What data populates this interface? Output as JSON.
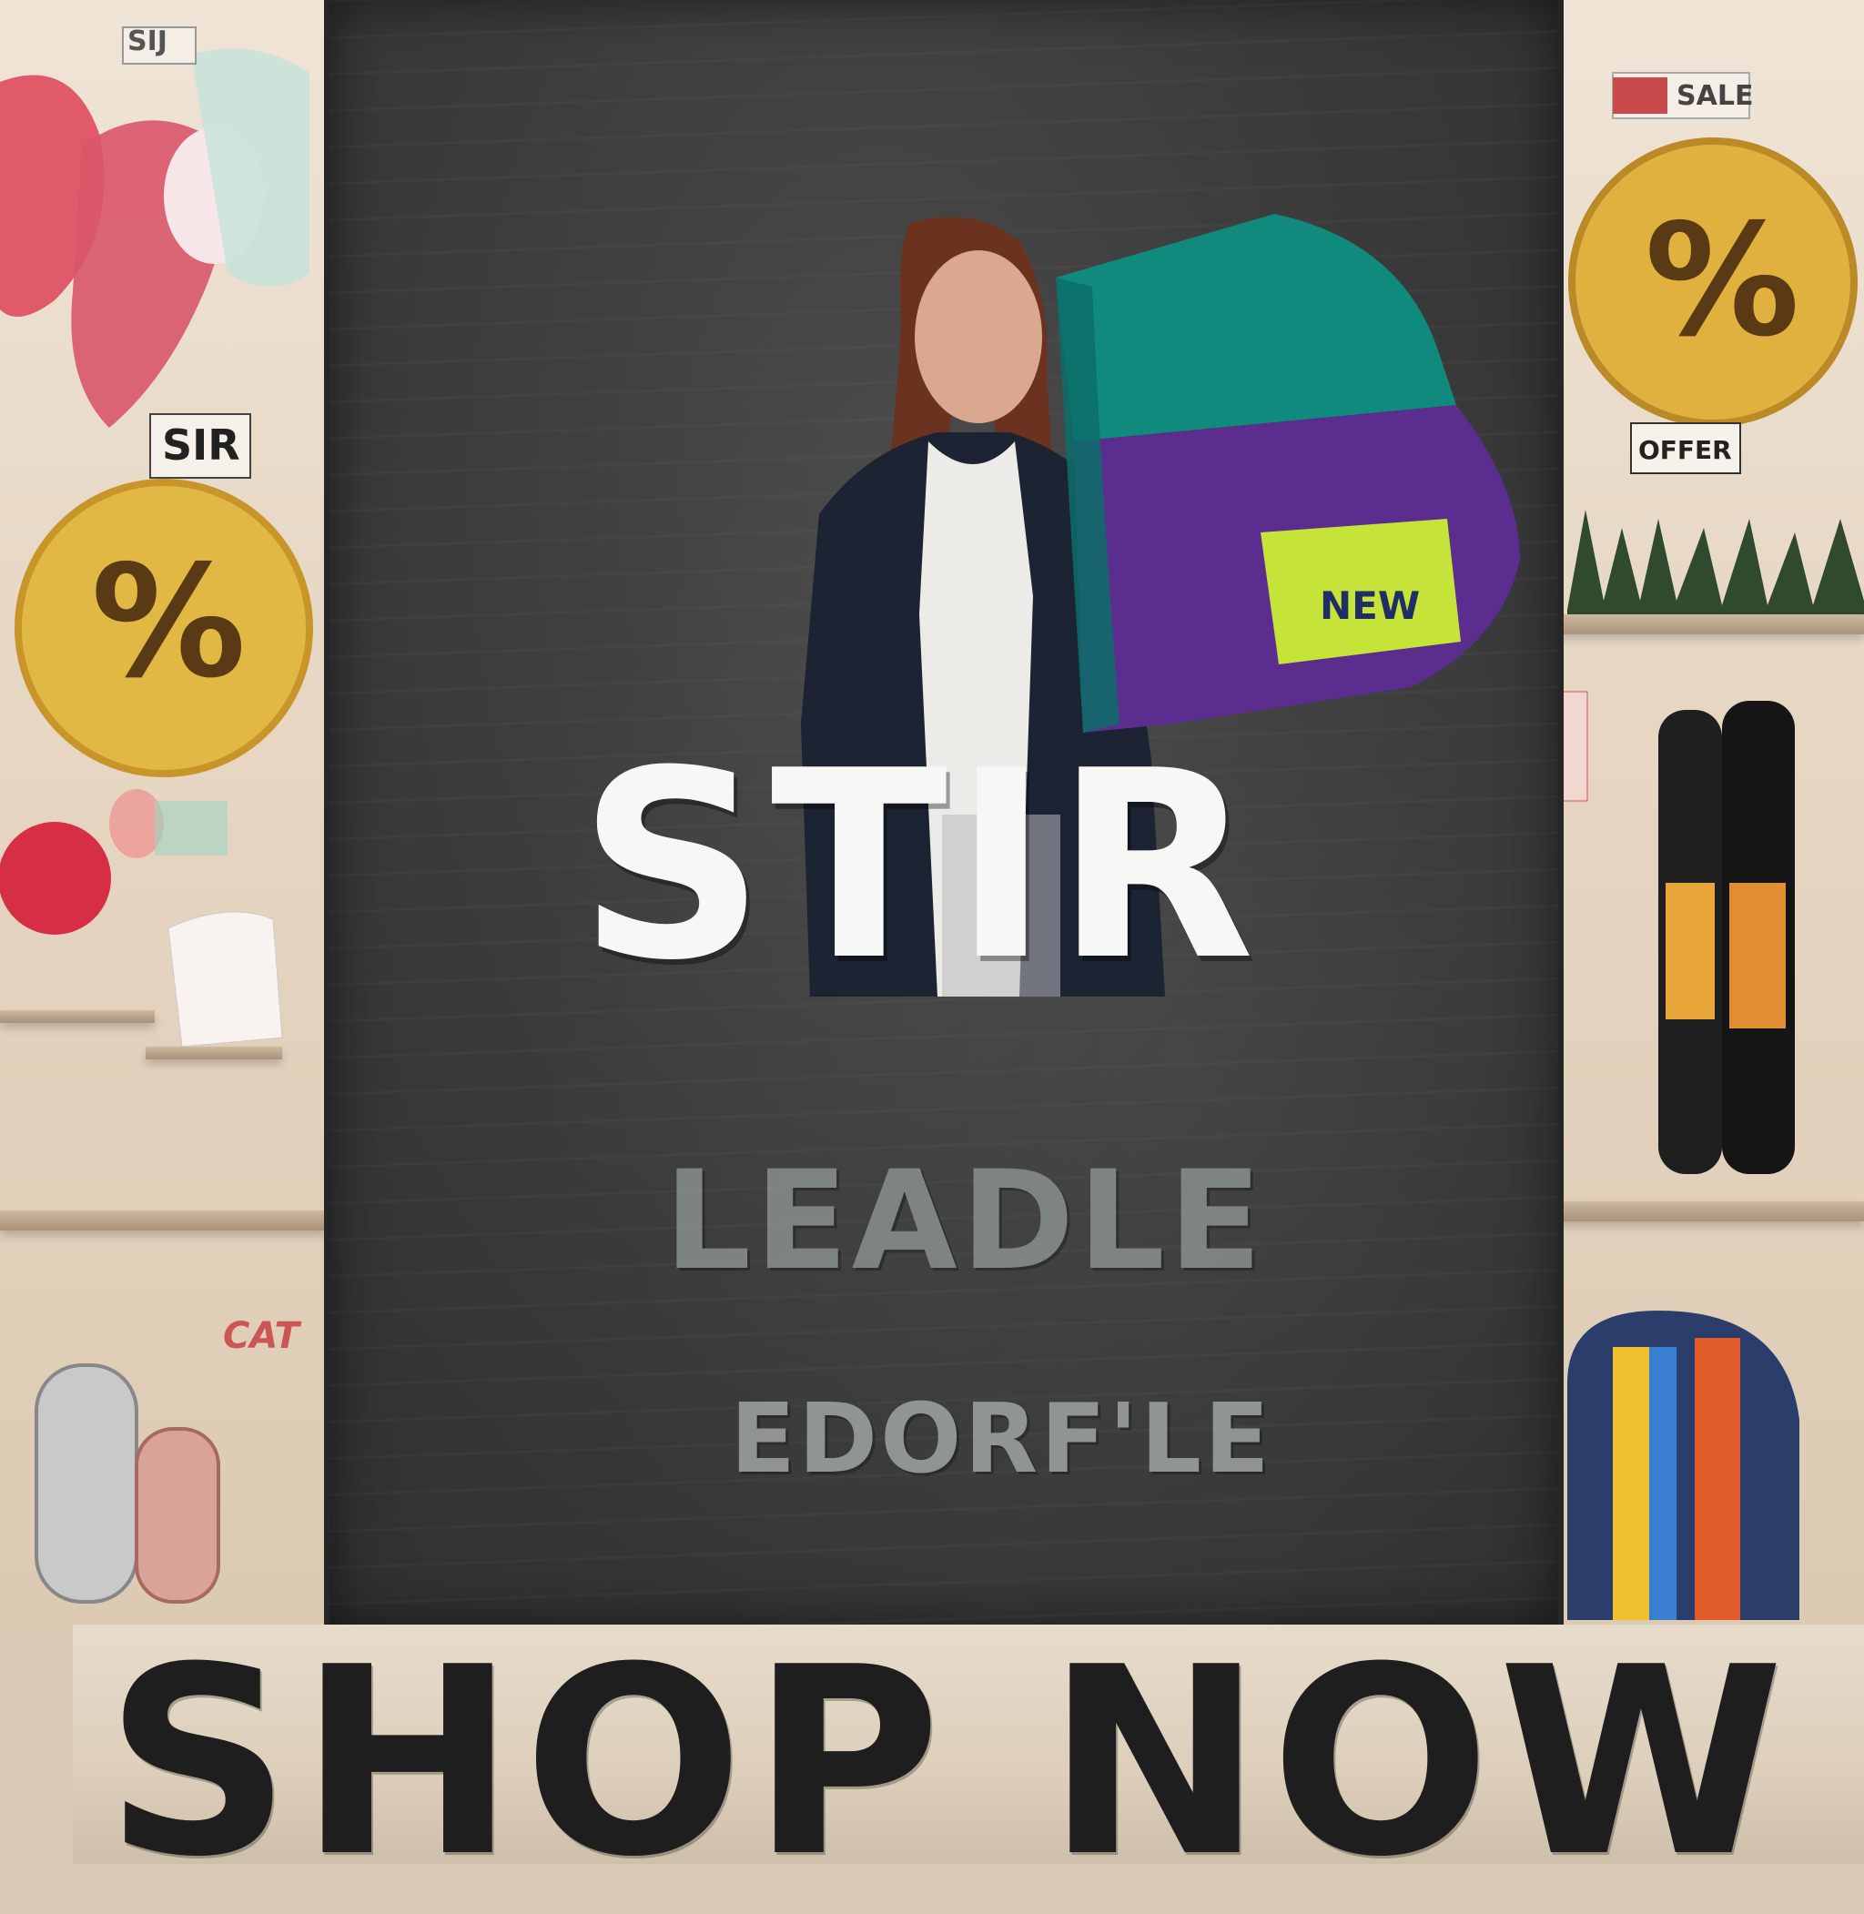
{
  "poster": {
    "headline": "STIR",
    "faded_line_1": "LEADLE",
    "faded_line_2": "EDORF'LE",
    "banner": "SHOP NOW",
    "sign_badge": "NEW"
  },
  "side_signs": {
    "left_top": "SIJ",
    "left_mid": "SIR",
    "left_low": "CAT",
    "right_top": "SALE",
    "right_mid": "OFFER",
    "discount_symbol": "%"
  },
  "colors": {
    "board": "#3c3c3c",
    "headline": "#f7f7f5",
    "sign_teal": "#0f8a7c",
    "sign_purple": "#5b2d8f",
    "sign_tag": "#c6e33a",
    "banner_text": "#1e1e1e",
    "gold_coin": "#e2b845"
  }
}
